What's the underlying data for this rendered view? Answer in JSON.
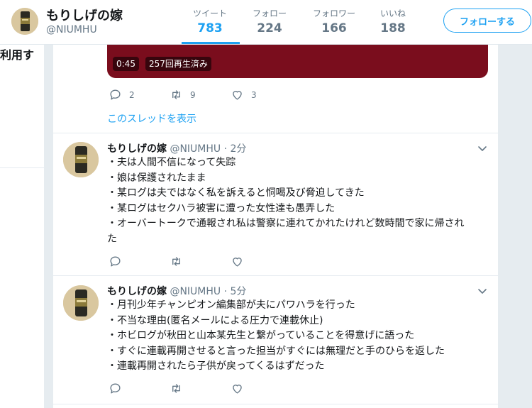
{
  "header": {
    "name": "もりしげの嫁",
    "handle": "@NIUMHU",
    "stats": [
      {
        "label": "ツイート",
        "value": "783"
      },
      {
        "label": "フォロー",
        "value": "224"
      },
      {
        "label": "フォロワー",
        "value": "166"
      },
      {
        "label": "いいね",
        "value": "188"
      }
    ],
    "follow_button": "フォローする"
  },
  "left_fragment": "利用す",
  "video": {
    "duration": "0:45",
    "views": "257回再生済み"
  },
  "first_actions": {
    "reply_count": "2",
    "retweet_count": "9",
    "like_count": "3"
  },
  "thread_link": "このスレッドを表示",
  "tweets": [
    {
      "name": "もりしげの嫁",
      "handle": "@NIUMHU",
      "time": "· 2分",
      "lines": [
        "・夫は人間不信になって失踪",
        "・娘は保護されたまま",
        "・某ログは夫ではなく私を訴えると恫喝及び脅迫してきた",
        "・某ログはセクハラ被害に遭った女性達も愚弄した",
        "・オーバートークで通報され私は警察に連れてかれたけれど数時間で家に帰され",
        "た"
      ]
    },
    {
      "name": "もりしげの嫁",
      "handle": "@NIUMHU",
      "time": "· 5分",
      "lines": [
        "・月刊少年チャンピオン編集部が夫にパワハラを行った",
        "・不当な理由(匿名メールによる圧力で連載休止)",
        "・ホビログが秋田と山本某先生と繋がっていることを得意げに語った",
        "・すぐに連載再開させると言った担当がすぐには無理だと手のひらを返した",
        "・連載再開されたら子供が戻ってくるはずだった"
      ]
    }
  ],
  "colors": {
    "accent": "#1da1f2",
    "video_bg": "#7a0d1d",
    "muted": "#657786"
  }
}
